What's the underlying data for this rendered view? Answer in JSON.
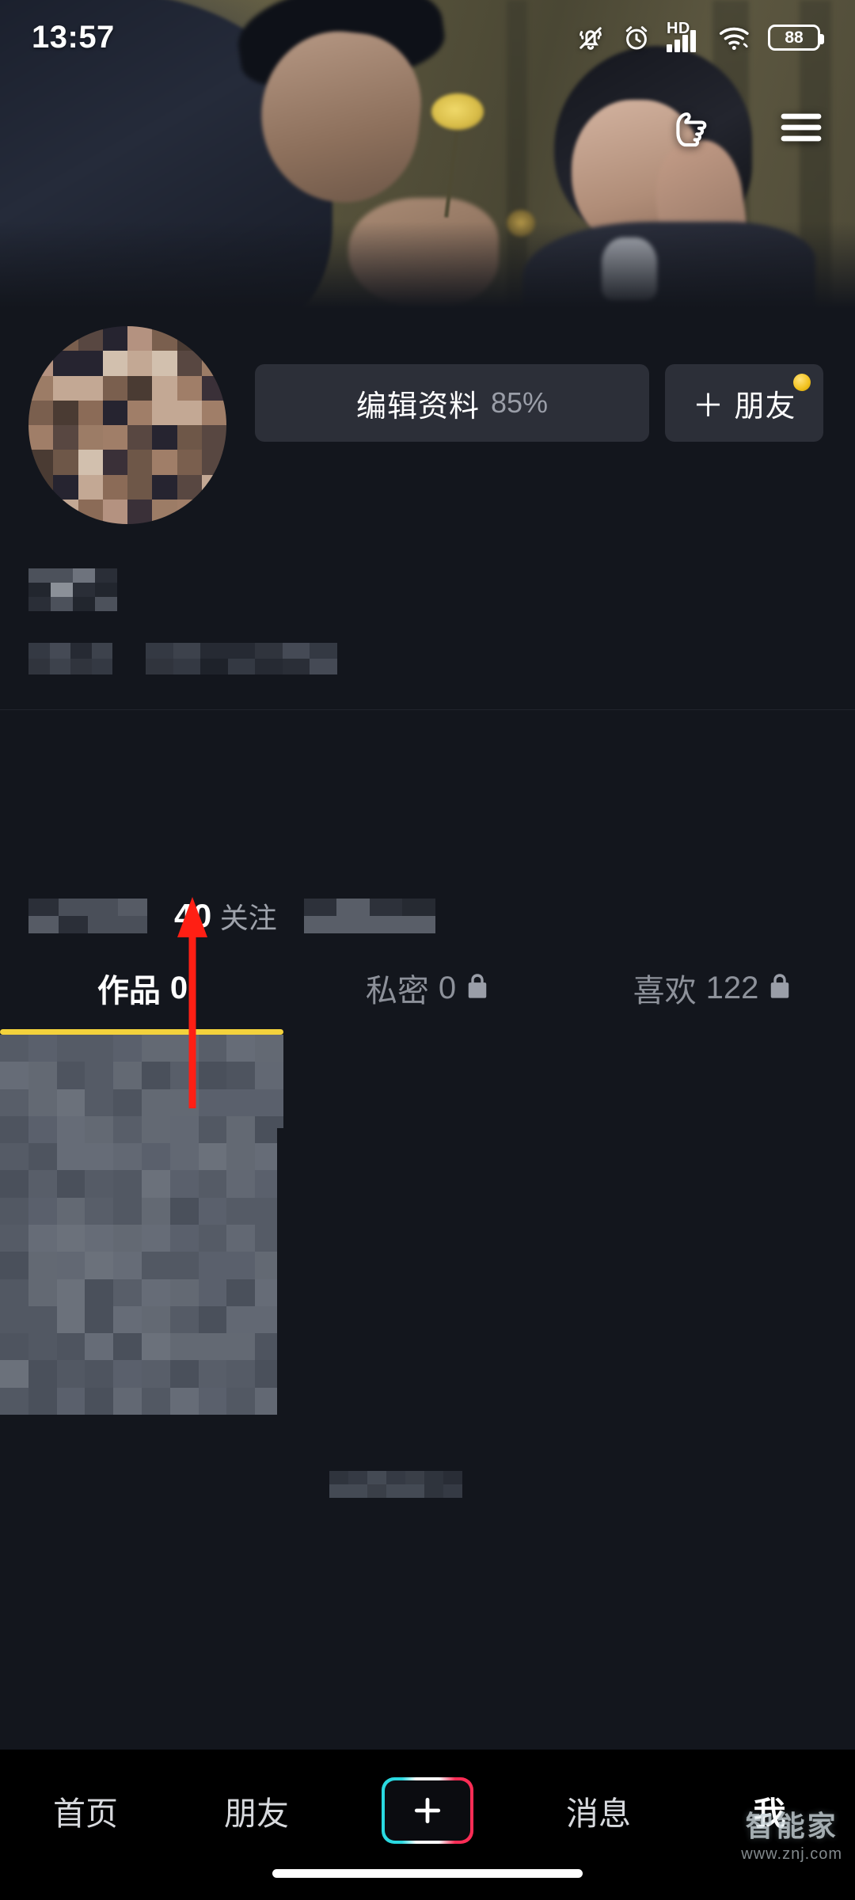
{
  "status_bar": {
    "time": "13:57",
    "hd_label": "HD",
    "battery_level": "88",
    "icons": [
      "bell-mute-icon",
      "alarm-clock-icon",
      "hd-signal-icon",
      "wifi-icon",
      "battery-icon"
    ]
  },
  "header": {
    "pointer_icon": "pointing-hand-icon",
    "menu_icon": "hamburger-menu-icon"
  },
  "profile": {
    "avatar": "mosaic-avatar",
    "edit_button": {
      "label": "编辑资料",
      "percent": "85%"
    },
    "friend_button": {
      "plus": "＋",
      "label": "朋友",
      "badge": "yellow-badge-dot"
    },
    "stats": {
      "count": "40",
      "label": "关注"
    }
  },
  "tabs": [
    {
      "label": "作品",
      "count": "0",
      "locked": false,
      "active": true
    },
    {
      "label": "私密",
      "count": "0",
      "locked": true,
      "active": false
    },
    {
      "label": "喜欢",
      "count": "122",
      "locked": true,
      "active": false
    }
  ],
  "bottom_nav": [
    {
      "label": "首页",
      "active": false
    },
    {
      "label": "朋友",
      "active": false
    },
    {
      "label": "+",
      "active": false,
      "is_plus": true
    },
    {
      "label": "消息",
      "active": false
    },
    {
      "label": "我",
      "active": true
    }
  ],
  "watermark": {
    "name": "智能家",
    "url": "www.znj.com"
  },
  "annotation": {
    "type": "red-arrow",
    "points_to": "40 关注",
    "color": "#ff1f14"
  },
  "colors": {
    "background": "#13161d",
    "nav_background": "#000000",
    "button": "#2c2f38",
    "accent_yellow": "#f3d23c",
    "muted_text": "#8d919a",
    "badge_yellow": "#f2c21f",
    "annotation_red": "#ff1f14"
  }
}
